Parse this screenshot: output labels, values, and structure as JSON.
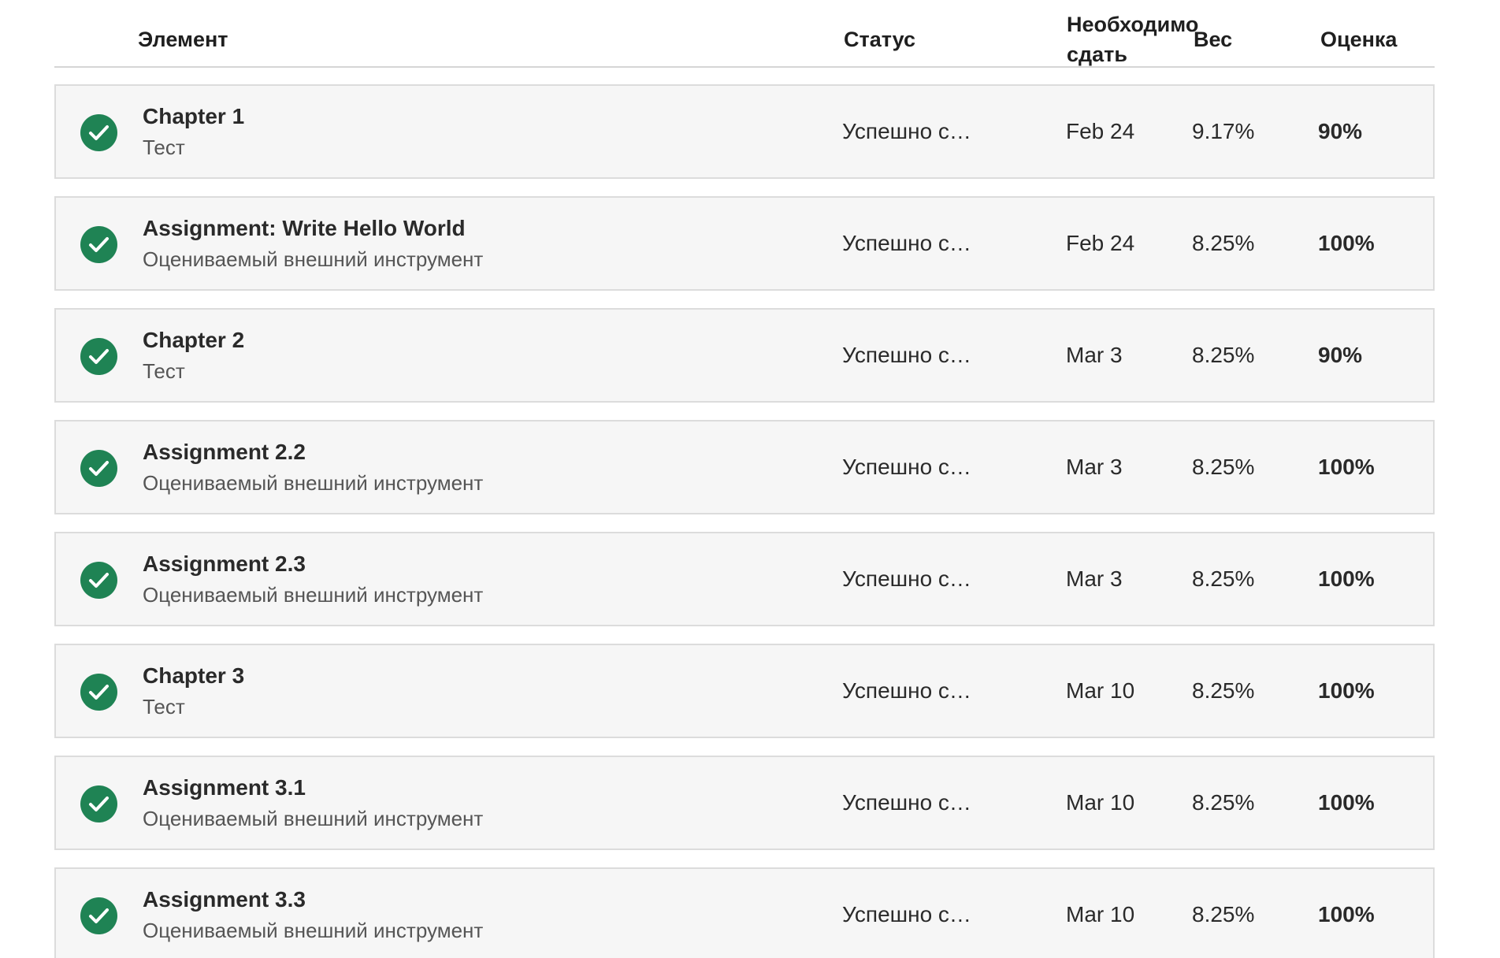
{
  "header": {
    "item": "Элемент",
    "status": "Статус",
    "due": "Необходимо сдать",
    "weight": "Вес",
    "grade": "Оценка"
  },
  "icons": {
    "completed": "check-circle-icon",
    "completed_color": "#1f8354"
  },
  "rows": [
    {
      "title": "Chapter 1",
      "subtitle": "Тест",
      "status": "Успешно с…",
      "due": "Feb 24",
      "weight": "9.17%",
      "grade": "90%"
    },
    {
      "title": "Assignment: Write Hello World",
      "subtitle": "Оцениваемый внешний инструмент",
      "status": "Успешно с…",
      "due": "Feb 24",
      "weight": "8.25%",
      "grade": "100%"
    },
    {
      "title": "Chapter 2",
      "subtitle": "Тест",
      "status": "Успешно с…",
      "due": "Mar 3",
      "weight": "8.25%",
      "grade": "90%"
    },
    {
      "title": "Assignment 2.2",
      "subtitle": "Оцениваемый внешний инструмент",
      "status": "Успешно с…",
      "due": "Mar 3",
      "weight": "8.25%",
      "grade": "100%"
    },
    {
      "title": "Assignment 2.3",
      "subtitle": "Оцениваемый внешний инструмент",
      "status": "Успешно с…",
      "due": "Mar 3",
      "weight": "8.25%",
      "grade": "100%"
    },
    {
      "title": "Chapter 3",
      "subtitle": "Тест",
      "status": "Успешно с…",
      "due": "Mar 10",
      "weight": "8.25%",
      "grade": "100%"
    },
    {
      "title": "Assignment 3.1",
      "subtitle": "Оцениваемый внешний инструмент",
      "status": "Успешно с…",
      "due": "Mar 10",
      "weight": "8.25%",
      "grade": "100%"
    },
    {
      "title": "Assignment 3.3",
      "subtitle": "Оцениваемый внешний инструмент",
      "status": "Успешно с…",
      "due": "Mar 10",
      "weight": "8.25%",
      "grade": "100%"
    }
  ]
}
